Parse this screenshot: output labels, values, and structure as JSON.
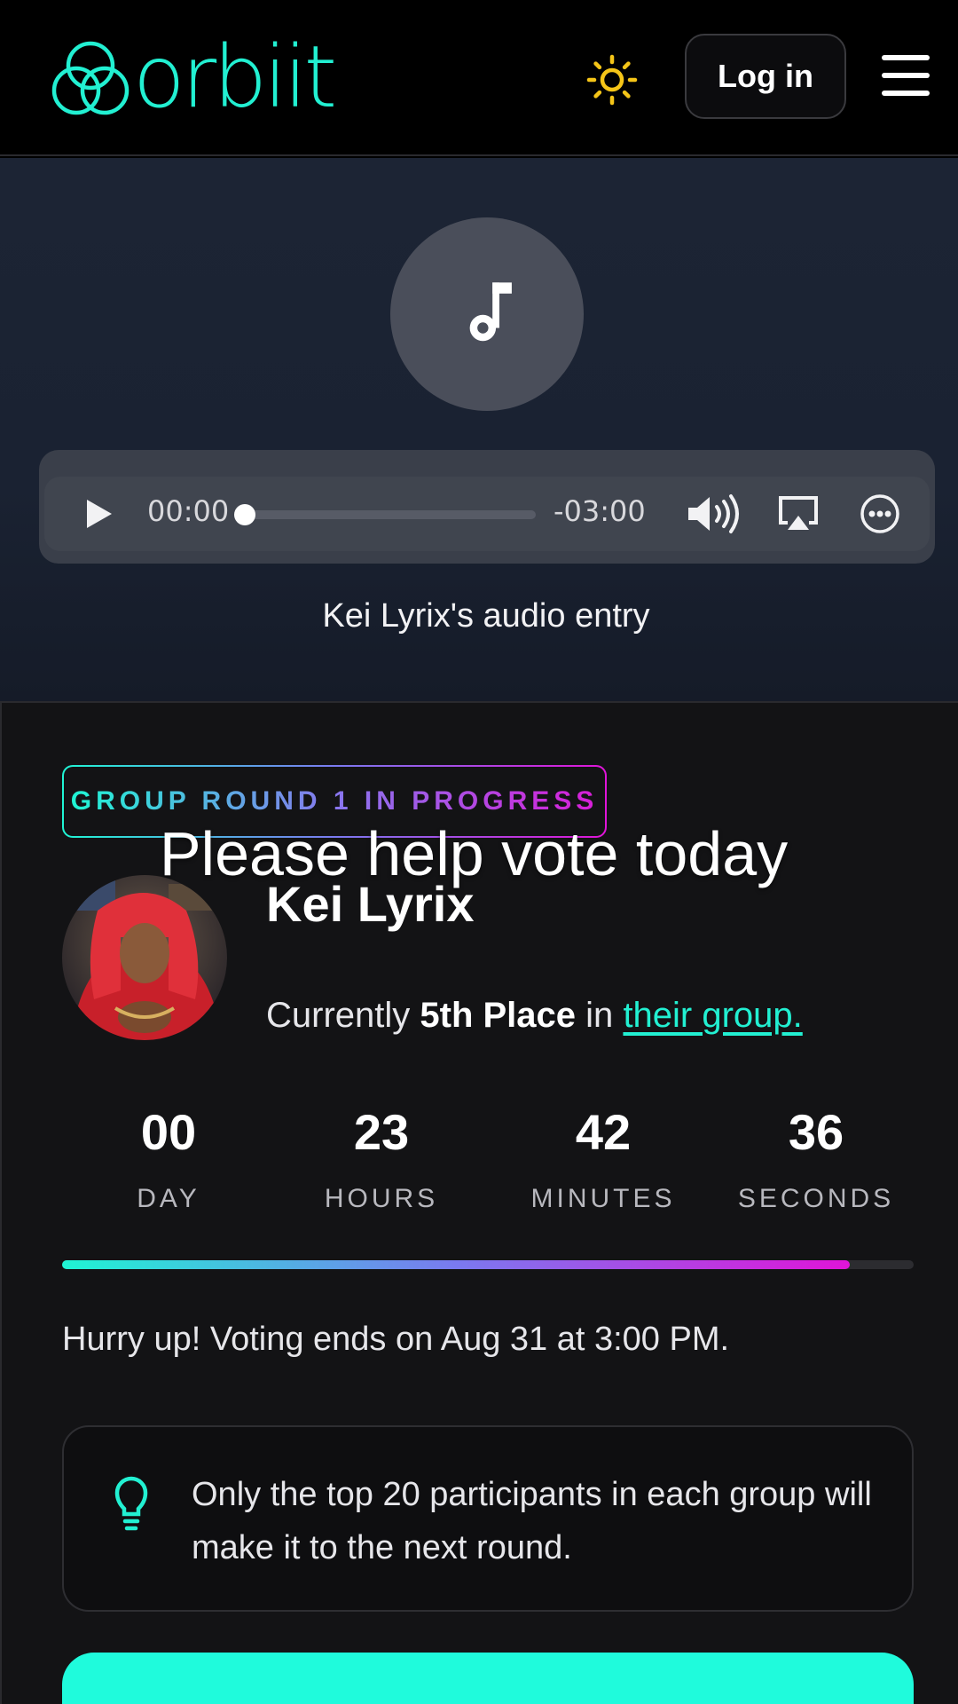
{
  "header": {
    "logo_text": "orbiit",
    "login_label": "Log in",
    "theme_icon": "sun-icon",
    "menu_icon": "hamburger-icon"
  },
  "player": {
    "icon": "music-note-icon",
    "current_time": "00:00",
    "remaining_time": "-03:00",
    "progress": 0,
    "caption": "Kei Lyrix's audio entry"
  },
  "entry": {
    "status_badge": "GROUP ROUND 1 IN PROGRESS",
    "overlay_text": "Please help vote today",
    "artist_name": "Kei Lyrix",
    "place_prefix": "Currently",
    "place_value": "5th Place",
    "place_mid": "in",
    "place_link": "their group."
  },
  "countdown": [
    {
      "value": "00",
      "label": "DAY"
    },
    {
      "value": "23",
      "label": "HOURS"
    },
    {
      "value": "42",
      "label": "MINUTES"
    },
    {
      "value": "36",
      "label": "SECONDS"
    }
  ],
  "vote_progress": 0.925,
  "hurry_text": "Hurry up! Voting ends on Aug 31 at 3:00 PM.",
  "tip": {
    "icon": "lightbulb-icon",
    "text": "Only the top 20 participants in each group will make it to the next round."
  },
  "colors": {
    "accent": "#1ff5d4",
    "accent_pink": "#e014d8",
    "sun": "#f5c518",
    "background": "#131315"
  }
}
